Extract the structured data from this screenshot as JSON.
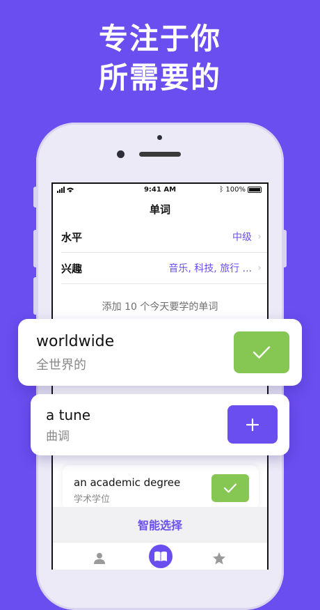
{
  "headline": {
    "line1": "专注于你",
    "line2": "所需要的"
  },
  "status_bar": {
    "time": "9:41 AM",
    "battery": "100%"
  },
  "nav": {
    "title": "单词"
  },
  "settings": [
    {
      "label": "水平",
      "value": "中级"
    },
    {
      "label": "兴趣",
      "value": "音乐, 科技, 旅行 ..."
    }
  ],
  "hint": "添加 10 个今天要学的单词",
  "cards": [
    {
      "word": "worldwide",
      "translation": "全世界的",
      "action": "check"
    },
    {
      "word": "a tune",
      "translation": "曲调",
      "action": "add"
    },
    {
      "word": "an academic degree",
      "translation": "学术学位",
      "action": "check"
    }
  ],
  "smart_button": "智能选择",
  "tabs": [
    {
      "icon": "person-icon"
    },
    {
      "icon": "book-icon"
    },
    {
      "icon": "star-icon"
    }
  ],
  "colors": {
    "accent": "#6b4ef0",
    "check": "#86c653"
  }
}
